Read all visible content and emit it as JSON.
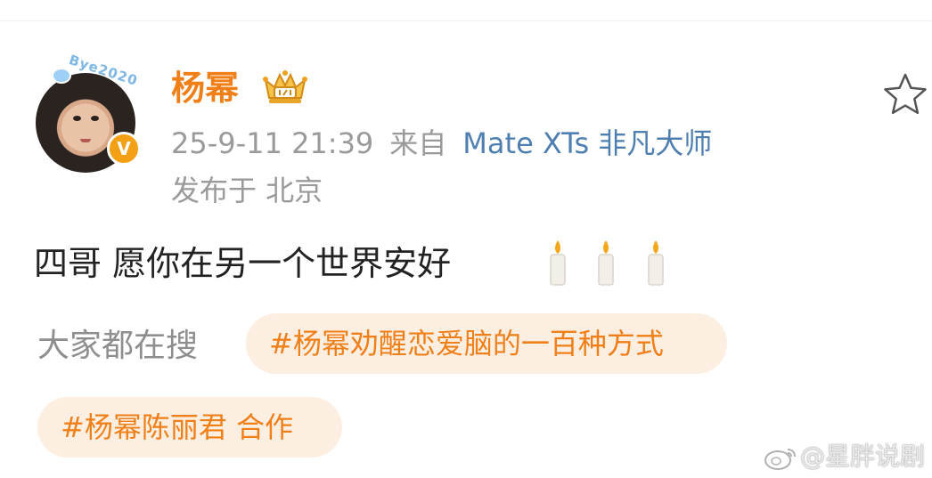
{
  "post": {
    "author": {
      "name": "杨幂",
      "avatar_frame_text": "Bye2020",
      "verified_badge": "V"
    },
    "meta": {
      "time": "25-9-11 21:39",
      "from_label": "来自",
      "device": "Mate XTs 非凡大师",
      "location": "发布于 北京"
    },
    "text": "四哥  愿你在另一个世界安好",
    "icons": [
      "vip-crown-icon",
      "favorite-star-icon",
      "candle-icon"
    ]
  },
  "trending": {
    "label": "大家都在搜",
    "tags": [
      "#杨幂劝醒恋爱脑的一百种方式",
      "#杨幂陈丽君 合作"
    ]
  },
  "watermark": {
    "text": "@星胖说剧"
  },
  "colors": {
    "username": "#f07f18",
    "device_link": "#4f7fb0",
    "tag_bg": "#fcefe2",
    "tag_text": "#f07f18",
    "meta_gray": "#9a9a9a"
  }
}
